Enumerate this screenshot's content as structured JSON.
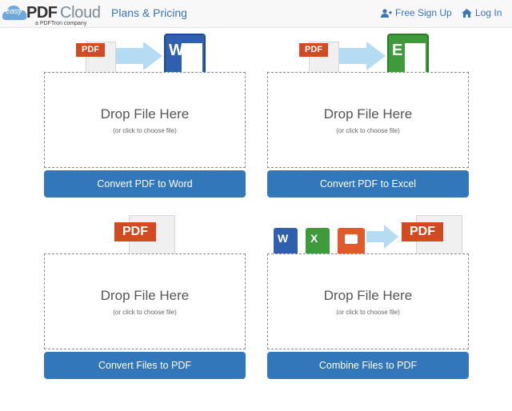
{
  "header": {
    "logo_easy": "easy",
    "logo_pdf": "PDF",
    "logo_cloud": "Cloud",
    "logo_tagline": "a PDFTron company",
    "plans_label": "Plans & Pricing",
    "signup_label": "Free Sign Up",
    "login_label": "Log In"
  },
  "icons": {
    "pdf_badge": "PDF",
    "word_letter": "W",
    "excel_letter": "E",
    "word_small": "W",
    "excel_small": "X"
  },
  "panels": [
    {
      "drop_title": "Drop File Here",
      "drop_sub": "(or click to choose file)",
      "button": "Convert PDF to Word"
    },
    {
      "drop_title": "Drop File Here",
      "drop_sub": "(or click to choose file)",
      "button": "Convert PDF to Excel"
    },
    {
      "drop_title": "Drop File Here",
      "drop_sub": "(or click to choose file)",
      "button": "Convert Files to PDF"
    },
    {
      "drop_title": "Drop File Here",
      "drop_sub": "(or click to choose file)",
      "button": "Combine Files to PDF"
    }
  ],
  "colors": {
    "accent": "#3277ba",
    "pdf_red": "#d24a21",
    "word_blue": "#2f5fae",
    "excel_green": "#3e9a3a"
  }
}
